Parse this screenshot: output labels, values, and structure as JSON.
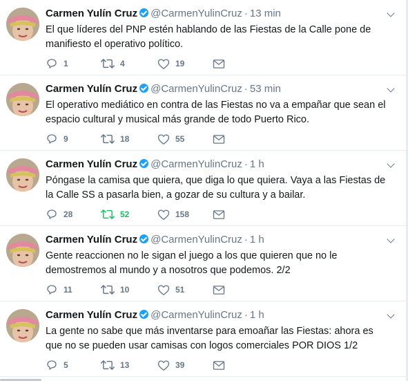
{
  "colors": {
    "accent": "#1da1f2",
    "retweet_active": "#17bf63",
    "muted": "#657786",
    "text": "#14171a"
  },
  "icons": {
    "reply": "reply-icon",
    "retweet": "retweet-icon",
    "like": "heart-icon",
    "dm": "envelope-icon",
    "verified": "verified-badge-icon",
    "caret": "chevron-down-icon"
  },
  "tweets": [
    {
      "name": "Carmen Yulín Cruz",
      "handle": "@CarmenYulinCruz",
      "separator": "·",
      "time": "13 min",
      "text": "El que líderes del PNP estén hablando de las Fiestas de la Calle pone de manifiesto el operativo político.",
      "replies": "1",
      "retweets": "4",
      "likes": "19",
      "retweeted": false
    },
    {
      "name": "Carmen Yulín Cruz",
      "handle": "@CarmenYulinCruz",
      "separator": "·",
      "time": "53 min",
      "text": "El operativo mediático en contra de las Fiestas no va a empañar que sean el espacio cultural y musical más grande de todo Puerto Rico.",
      "replies": "9",
      "retweets": "18",
      "likes": "55",
      "retweeted": false
    },
    {
      "name": "Carmen Yulín Cruz",
      "handle": "@CarmenYulinCruz",
      "separator": "·",
      "time": "1 h",
      "text": "Póngase la camisa que quiera, que diga lo que quiera. Vaya a las Fiestas de la Calle SS a pasarla bien, a gozar de su cultura y a bailar.",
      "replies": "28",
      "retweets": "52",
      "likes": "158",
      "retweeted": true
    },
    {
      "name": "Carmen Yulín Cruz",
      "handle": "@CarmenYulinCruz",
      "separator": "·",
      "time": "1 h",
      "text": "Gente reaccionen no le sigan el juego a los que quieren que no le demostremos al mundo y a nosotros que podemos.  2/2",
      "replies": "11",
      "retweets": "10",
      "likes": "51",
      "retweeted": false
    },
    {
      "name": "Carmen Yulín Cruz",
      "handle": "@CarmenYulinCruz",
      "separator": "·",
      "time": "1 h",
      "text": "La gente no sabe que más inventarse para emoañar las Fiestas: ahora es que no se pueden usar camisas con logos comerciales POR DIOS 1/2",
      "replies": "5",
      "retweets": "13",
      "likes": "39",
      "retweeted": false
    }
  ]
}
